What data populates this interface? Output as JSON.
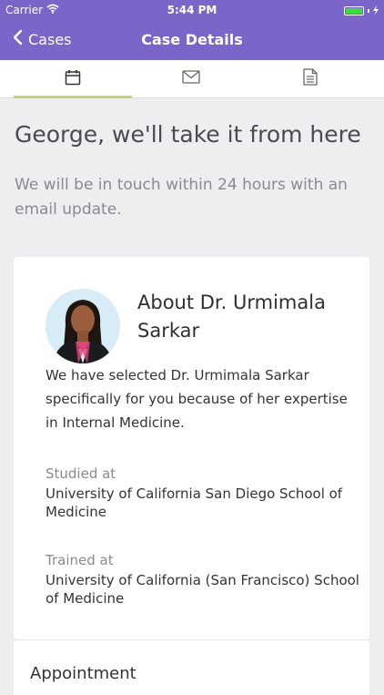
{
  "status": {
    "carrier": "Carrier",
    "time": "5:44 PM"
  },
  "nav": {
    "back_label": "Cases",
    "title": "Case Details"
  },
  "tabs": [
    {
      "icon": "calendar-icon",
      "active": true
    },
    {
      "icon": "mail-icon",
      "active": false
    },
    {
      "icon": "document-icon",
      "active": false
    }
  ],
  "headline": "George, we'll take it from here",
  "subline": "We will be in touch within 24 hours with an email update.",
  "doctor": {
    "title": "About Dr. Urmimala Sarkar",
    "description": "We have selected Dr. Urmimala Sarkar specifically for you because of her expertise in Internal Medicine.",
    "studied_label": "Studied at",
    "studied_value": "University of California San Diego School of Medicine",
    "trained_label": "Trained at",
    "trained_value": "University of California (San Francisco) School of Medicine"
  },
  "appointment": {
    "title": "Appointment"
  },
  "colors": {
    "header": "#7b65c8",
    "tab_accent": "#c4d17a",
    "battery": "#3ddc3d",
    "background": "#eeedf0"
  }
}
